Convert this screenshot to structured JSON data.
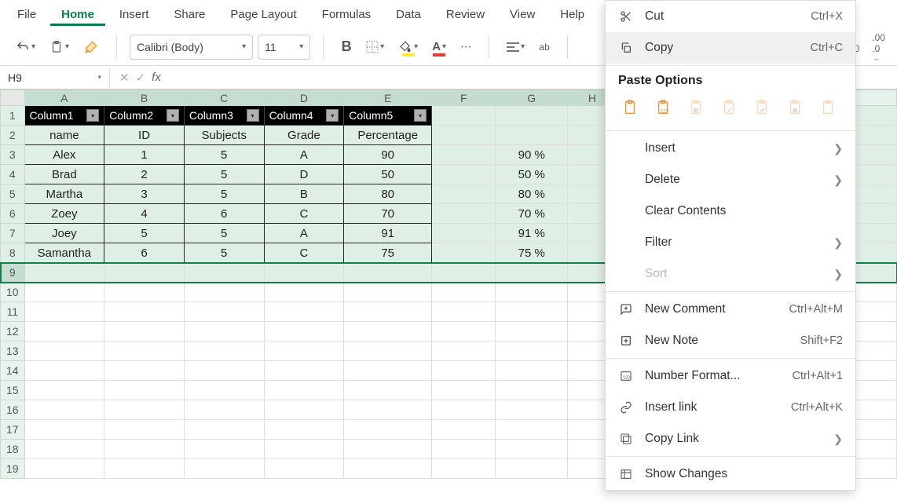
{
  "menu": {
    "items": [
      "File",
      "Home",
      "Insert",
      "Share",
      "Page Layout",
      "Formulas",
      "Data",
      "Review",
      "View",
      "Help"
    ],
    "active": "Home"
  },
  "toolbar": {
    "font_name": "Calibri (Body)",
    "font_size": "11",
    "bold": "B"
  },
  "formula_bar": {
    "name_box": "H9",
    "fx": "fx",
    "formula": ""
  },
  "columns": [
    "A",
    "B",
    "C",
    "D",
    "E",
    "F",
    "G",
    "H"
  ],
  "table": {
    "headers": [
      "Column1",
      "Column2",
      "Column3",
      "Column4",
      "Column5"
    ],
    "row2": [
      "name",
      "ID",
      "Subjects",
      "Grade",
      "Percentage"
    ],
    "data": [
      [
        "Alex",
        "1",
        "5",
        "A",
        "90"
      ],
      [
        "Brad",
        "2",
        "5",
        "D",
        "50"
      ],
      [
        "Martha",
        "3",
        "5",
        "B",
        "80"
      ],
      [
        "Zoey",
        "4",
        "6",
        "C",
        "70"
      ],
      [
        "Joey",
        "5",
        "5",
        "A",
        "91"
      ],
      [
        "Samantha",
        "6",
        "5",
        "C",
        "75"
      ]
    ],
    "g_values": [
      "90 %",
      "50 %",
      "80 %",
      "70 %",
      "91 %",
      "75 %"
    ]
  },
  "context_menu": {
    "cut": "Cut",
    "cut_key": "Ctrl+X",
    "copy": "Copy",
    "copy_key": "Ctrl+C",
    "paste_header": "Paste Options",
    "insert": "Insert",
    "delete": "Delete",
    "clear": "Clear Contents",
    "filter": "Filter",
    "sort": "Sort",
    "new_comment": "New Comment",
    "new_comment_key": "Ctrl+Alt+M",
    "new_note": "New Note",
    "new_note_key": "Shift+F2",
    "number_format": "Number Format...",
    "number_format_key": "Ctrl+Alt+1",
    "insert_link": "Insert link",
    "insert_link_key": "Ctrl+Alt+K",
    "copy_link": "Copy Link",
    "show_changes": "Show Changes"
  }
}
